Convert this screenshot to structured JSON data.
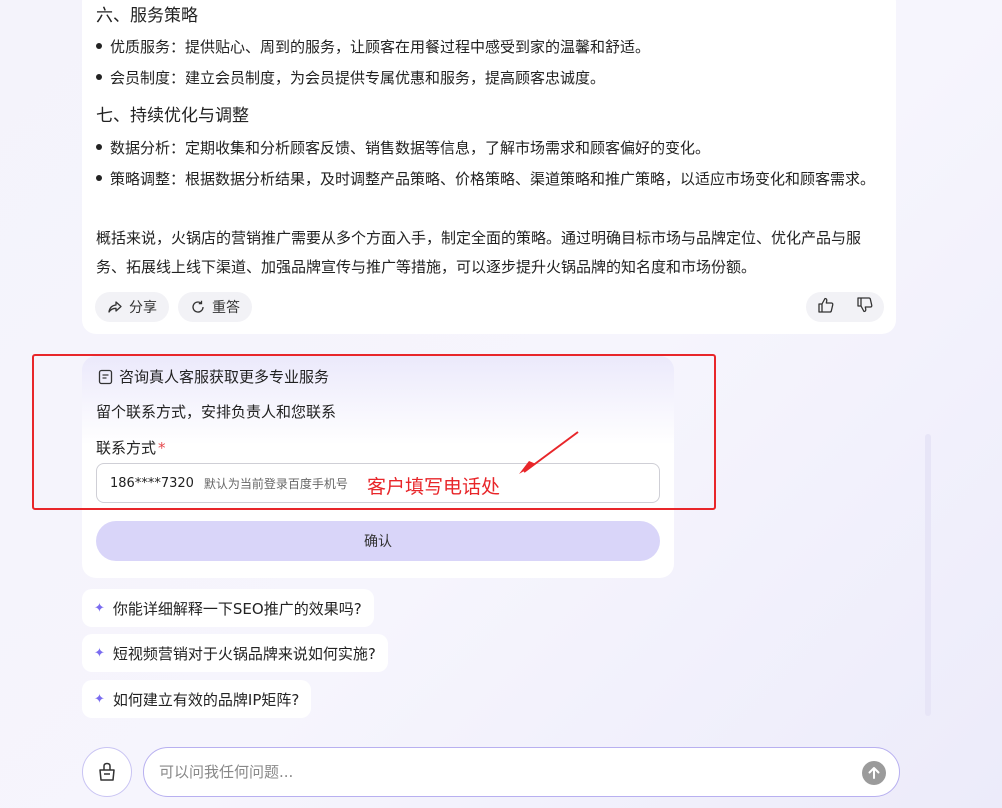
{
  "answer": {
    "section6_title": "六、服务策略",
    "section6_items": [
      "优质服务：提供贴心、周到的服务，让顾客在用餐过程中感受到家的温馨和舒适。",
      "会员制度：建立会员制度，为会员提供专属优惠和服务，提高顾客忠诚度。"
    ],
    "section7_title": "七、持续优化与调整",
    "section7_items": [
      "数据分析：定期收集和分析顾客反馈、销售数据等信息，了解市场需求和顾客偏好的变化。",
      "策略调整：根据数据分析结果，及时调整产品策略、价格策略、渠道策略和推广策略，以适应市场变化和顾客需求。"
    ],
    "summary": "概括来说，火锅店的营销推广需要从多个方面入手，制定全面的策略。通过明确目标市场与品牌定位、优化产品与服务、拓展线上线下渠道、加强品牌宣传与推广等措施，可以逐步提升火锅品牌的知名度和市场份额。",
    "share_label": "分享",
    "regenerate_label": "重答"
  },
  "form": {
    "title": "咨询真人客服获取更多专业服务",
    "subtitle": "留个联系方式，安排负责人和您联系",
    "contact_label": "联系方式",
    "required_mark": "*",
    "phone_value": "186****7320",
    "phone_hint": "默认为当前登录百度手机号",
    "confirm_label": "确认"
  },
  "annotation": {
    "text": "客户填写电话处",
    "color": "#e8262a"
  },
  "suggestions": [
    "你能详细解释一下SEO推广的效果吗?",
    "短视频营销对于火锅品牌来说如何实施?",
    "如何建立有效的品牌IP矩阵?"
  ],
  "composer": {
    "placeholder": "可以问我任何问题..."
  },
  "icons": [
    "share-icon",
    "refresh-icon",
    "thumbs-up-icon",
    "thumbs-down-icon",
    "document-icon",
    "sparkle-icon",
    "toolbox-icon",
    "send-arrow-icon"
  ],
  "colors": {
    "accent": "#7a6cf0",
    "confirm_bg": "#d9d5f9",
    "highlight_red": "#e8262a"
  }
}
